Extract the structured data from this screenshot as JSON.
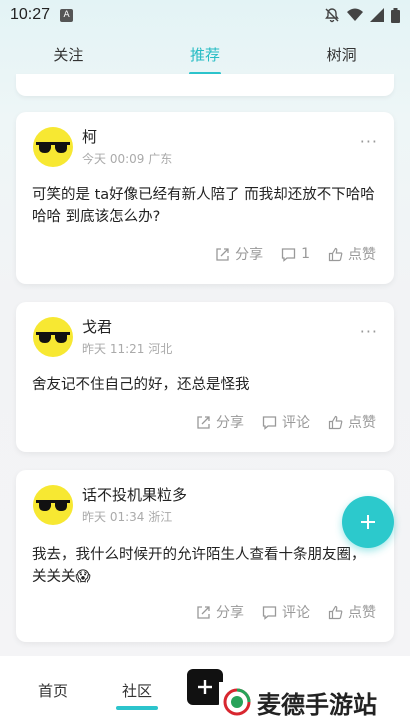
{
  "status_bar": {
    "time": "10:27",
    "app_icon": "A"
  },
  "top_tabs": [
    {
      "label": "关注",
      "active": false
    },
    {
      "label": "推荐",
      "active": true
    },
    {
      "label": "树洞",
      "active": false
    }
  ],
  "accent_color": "#2cc4cc",
  "posts": [
    {
      "username": "柯",
      "meta": "今天 00:09 广东",
      "text": "可笑的是 ta好像已经有新人陪了 而我却还放不下哈哈哈哈 到底该怎么办?",
      "share_label": "分享",
      "comment_label": "1",
      "like_label": "点赞"
    },
    {
      "username": "戈君",
      "meta": "昨天 11:21 河北",
      "text": "舍友记不住自己的好，还总是怪我",
      "share_label": "分享",
      "comment_label": "评论",
      "like_label": "点赞"
    },
    {
      "username": "话不投机果粒多",
      "meta": "昨天 01:34 浙江",
      "text": "我去，我什么时候开的允许陌生人查看十条朋友圈，关关关😱",
      "share_label": "分享",
      "comment_label": "评论",
      "like_label": "点赞"
    }
  ],
  "more_glyph": "···",
  "bottom_nav": [
    {
      "label": "首页",
      "active": false
    },
    {
      "label": "社区",
      "active": true
    }
  ],
  "watermark": {
    "text": "麦德手游站"
  }
}
